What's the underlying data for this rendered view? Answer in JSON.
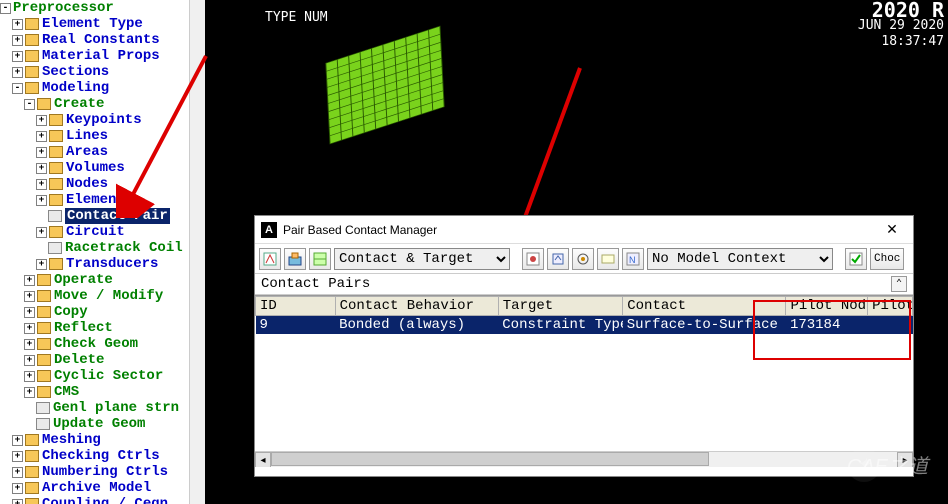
{
  "tree": {
    "root": "Preprocessor",
    "items": [
      {
        "label": "Element Type",
        "lvl": 1,
        "exp": "+",
        "cls": "blue"
      },
      {
        "label": "Real Constants",
        "lvl": 1,
        "exp": "+",
        "cls": "blue"
      },
      {
        "label": "Material Props",
        "lvl": 1,
        "exp": "+",
        "cls": "blue"
      },
      {
        "label": "Sections",
        "lvl": 1,
        "exp": "+",
        "cls": "blue"
      },
      {
        "label": "Modeling",
        "lvl": 1,
        "exp": "-",
        "cls": "blue"
      },
      {
        "label": "Create",
        "lvl": 2,
        "exp": "-",
        "cls": ""
      },
      {
        "label": "Keypoints",
        "lvl": 3,
        "exp": "+",
        "cls": "blue"
      },
      {
        "label": "Lines",
        "lvl": 3,
        "exp": "+",
        "cls": "blue"
      },
      {
        "label": "Areas",
        "lvl": 3,
        "exp": "+",
        "cls": "blue"
      },
      {
        "label": "Volumes",
        "lvl": 3,
        "exp": "+",
        "cls": "blue"
      },
      {
        "label": "Nodes",
        "lvl": 3,
        "exp": "+",
        "cls": "blue"
      },
      {
        "label": "Elements",
        "lvl": 3,
        "exp": "+",
        "cls": "blue"
      },
      {
        "label": "Contact Pair",
        "lvl": 3,
        "exp": "",
        "cls": "sel",
        "leaf": true
      },
      {
        "label": "Circuit",
        "lvl": 3,
        "exp": "+",
        "cls": "blue"
      },
      {
        "label": "Racetrack Coil",
        "lvl": 3,
        "exp": "",
        "cls": "",
        "leaf": true
      },
      {
        "label": "Transducers",
        "lvl": 3,
        "exp": "+",
        "cls": "blue"
      },
      {
        "label": "Operate",
        "lvl": 2,
        "exp": "+",
        "cls": ""
      },
      {
        "label": "Move / Modify",
        "lvl": 2,
        "exp": "+",
        "cls": ""
      },
      {
        "label": "Copy",
        "lvl": 2,
        "exp": "+",
        "cls": ""
      },
      {
        "label": "Reflect",
        "lvl": 2,
        "exp": "+",
        "cls": ""
      },
      {
        "label": "Check Geom",
        "lvl": 2,
        "exp": "+",
        "cls": ""
      },
      {
        "label": "Delete",
        "lvl": 2,
        "exp": "+",
        "cls": ""
      },
      {
        "label": "Cyclic Sector",
        "lvl": 2,
        "exp": "+",
        "cls": ""
      },
      {
        "label": "CMS",
        "lvl": 2,
        "exp": "+",
        "cls": ""
      },
      {
        "label": "Genl plane strn",
        "lvl": 2,
        "exp": "",
        "cls": "",
        "leaf": true
      },
      {
        "label": "Update Geom",
        "lvl": 2,
        "exp": "",
        "cls": "",
        "leaf": true
      },
      {
        "label": "Meshing",
        "lvl": 1,
        "exp": "+",
        "cls": "blue"
      },
      {
        "label": "Checking Ctrls",
        "lvl": 1,
        "exp": "+",
        "cls": "blue"
      },
      {
        "label": "Numbering Ctrls",
        "lvl": 1,
        "exp": "+",
        "cls": "blue"
      },
      {
        "label": "Archive Model",
        "lvl": 1,
        "exp": "+",
        "cls": "blue"
      },
      {
        "label": "Coupling / Ceqn",
        "lvl": 1,
        "exp": "+",
        "cls": "blue"
      }
    ]
  },
  "viewport": {
    "label": "TYPE NUM",
    "version": "2020 R",
    "date": "JUN 29 2020",
    "time": "18:37:47"
  },
  "dialog": {
    "title": "Pair Based Contact Manager",
    "select1": "Contact & Target",
    "select2": "No Model Context",
    "btn_choc": "Choc",
    "list_title": "Contact Pairs",
    "columns": [
      "ID",
      "Contact Behavior",
      "Target",
      "Contact",
      "Pilot Node",
      "Pilot"
    ],
    "row": {
      "id": "9",
      "behavior": "Bonded (always)",
      "target": "Constraint Type",
      "contact": "Surface-to-Surface",
      "pilot_node": "173184",
      "pilot": ""
    }
  },
  "watermark": "CAE之道"
}
